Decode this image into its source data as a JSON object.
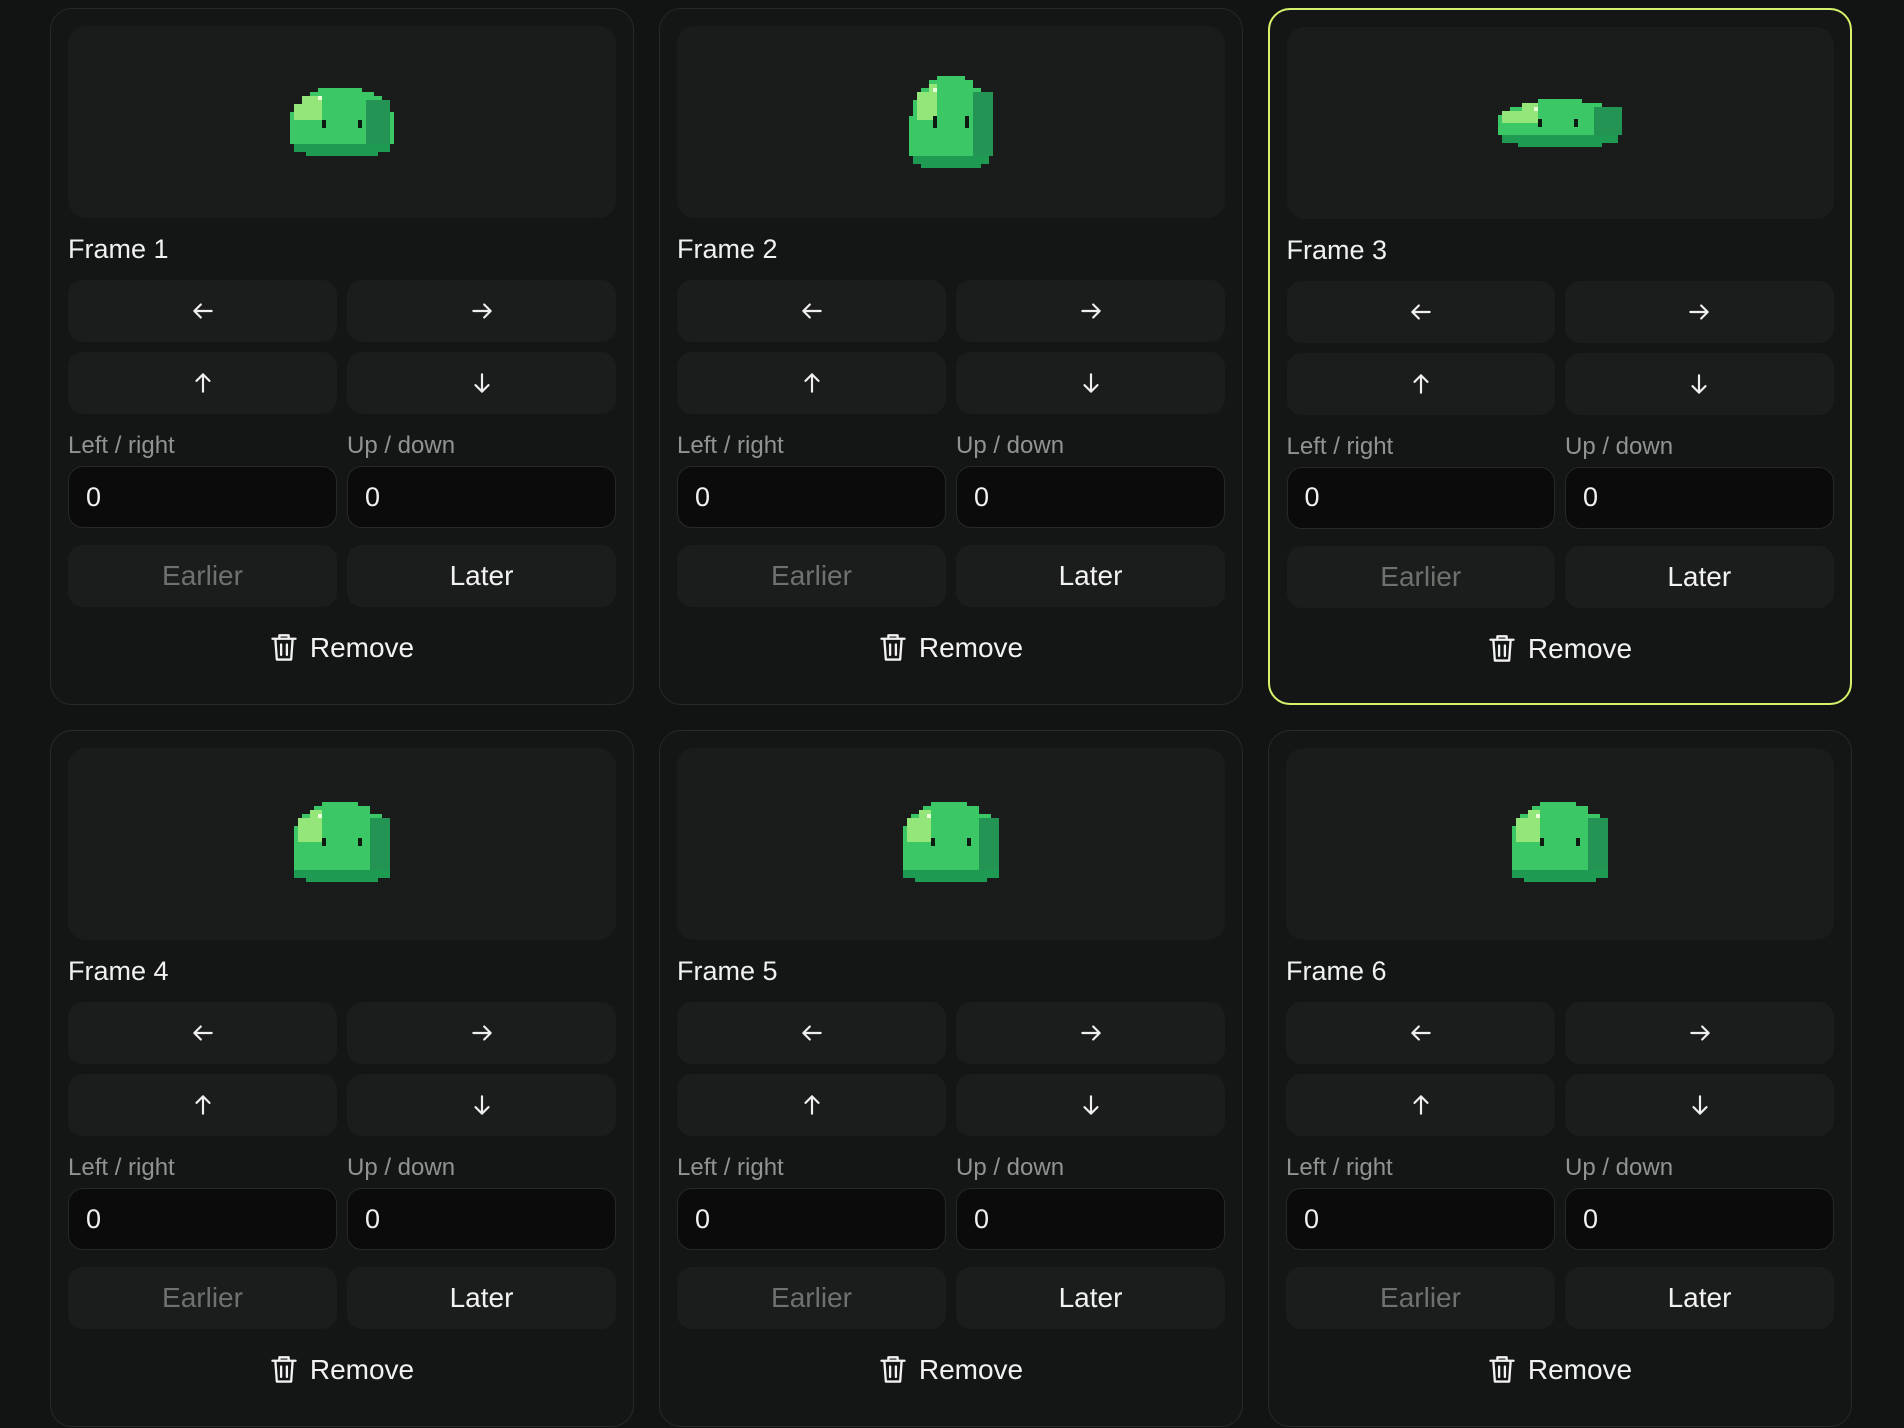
{
  "frames": [
    {
      "title": "Frame 1",
      "x_label": "Left / right",
      "y_label": "Up / down",
      "x_value": "0",
      "y_value": "0",
      "earlier": "Earlier",
      "later": "Later",
      "remove": "Remove",
      "selected": false,
      "earlier_disabled": true,
      "sprite": "slime-squash"
    },
    {
      "title": "Frame 2",
      "x_label": "Left / right",
      "y_label": "Up / down",
      "x_value": "0",
      "y_value": "0",
      "earlier": "Earlier",
      "later": "Later",
      "remove": "Remove",
      "selected": false,
      "earlier_disabled": false,
      "sprite": "slime-stretch"
    },
    {
      "title": "Frame 3",
      "x_label": "Left / right",
      "y_label": "Up / down",
      "x_value": "0",
      "y_value": "0",
      "earlier": "Earlier",
      "later": "Later",
      "remove": "Remove",
      "selected": true,
      "earlier_disabled": false,
      "sprite": "slime-flat"
    },
    {
      "title": "Frame 4",
      "x_label": "Left / right",
      "y_label": "Up / down",
      "x_value": "0",
      "y_value": "0",
      "earlier": "Earlier",
      "later": "Later",
      "remove": "Remove",
      "selected": false,
      "earlier_disabled": false,
      "sprite": "slime-round"
    },
    {
      "title": "Frame 5",
      "x_label": "Left / right",
      "y_label": "Up / down",
      "x_value": "0",
      "y_value": "0",
      "earlier": "Earlier",
      "later": "Later",
      "remove": "Remove",
      "selected": false,
      "earlier_disabled": false,
      "sprite": "slime-round"
    },
    {
      "title": "Frame 6",
      "x_label": "Left / right",
      "y_label": "Up / down",
      "x_value": "0",
      "y_value": "0",
      "earlier": "Earlier",
      "later": "Later",
      "remove": "Remove",
      "selected": false,
      "earlier_disabled": false,
      "sprite": "slime-round"
    }
  ],
  "colors": {
    "accent": "#d4f26c",
    "slime_main": "#3cc766",
    "slime_highlight": "#94e67a",
    "slime_shadow": "#249455",
    "slime_base": "#1f9a52",
    "slime_eye": "#0d1a12"
  }
}
